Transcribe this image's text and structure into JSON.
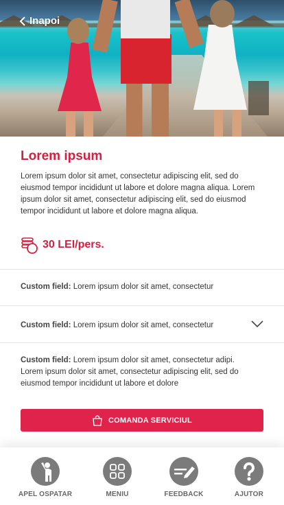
{
  "header": {
    "back_label": "Inapoi"
  },
  "service": {
    "title": "Lorem ipsum",
    "description": "Lorem ipsum dolor sit amet, consectetur adipiscing elit, sed do eiusmod tempor incididunt ut labore et dolore magna aliqua. Lorem ipsum dolor sit amet, consectetur adipiscing elit, sed do eiusmod tempor incididunt ut labore et dolore magna aliqua.",
    "price": "30 LEI/pers."
  },
  "custom_fields": [
    {
      "label": "Custom field:",
      "value": "Lorem ipsum dolor sit amet, consectetur"
    },
    {
      "label": "Custom field:",
      "value": "Lorem ipsum dolor sit amet, consectetur"
    },
    {
      "label": "Custom field:",
      "value": "Lorem ipsum dolor sit amet, consectetur adipi. Lorem ipsum dolor sit amet, consectetur adipiscing elit, sed do eiusmod tempor incididunt ut labore et dolore"
    }
  ],
  "cta": {
    "label": "COMANDA SERVICIUL"
  },
  "nav": [
    {
      "label": "APEL OSPATAR",
      "icon": "waiter-icon"
    },
    {
      "label": "MENIU",
      "icon": "grid-menu-icon"
    },
    {
      "label": "FEEDBACK",
      "icon": "feedback-pen-icon"
    },
    {
      "label": "AJUTOR",
      "icon": "question-icon"
    }
  ],
  "colors": {
    "accent": "#e0234a",
    "title": "#d4203e",
    "nav_icon": "#7b7b7b"
  }
}
